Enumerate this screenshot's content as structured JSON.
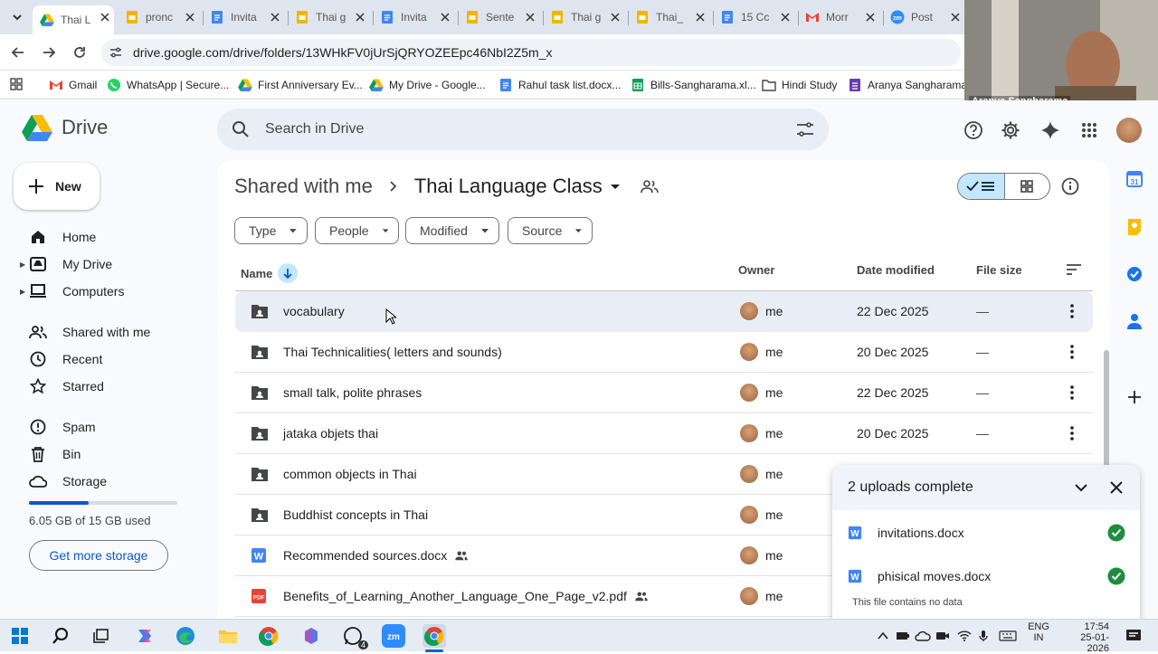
{
  "browser": {
    "tabs": [
      {
        "label": "Thai L",
        "icon": "drive-icon",
        "active": true
      },
      {
        "label": "pronc",
        "icon": "slides-icon"
      },
      {
        "label": "Invita",
        "icon": "docs-icon"
      },
      {
        "label": "Thai g",
        "icon": "slides-icon"
      },
      {
        "label": "Invita",
        "icon": "docs-icon"
      },
      {
        "label": "Sente",
        "icon": "slides-icon"
      },
      {
        "label": "Thai g",
        "icon": "slides-icon"
      },
      {
        "label": "Thai_",
        "icon": "slides-icon"
      },
      {
        "label": "15 Cc",
        "icon": "docs-icon"
      },
      {
        "label": "Morr",
        "icon": "gmail-icon"
      },
      {
        "label": "Post",
        "icon": "zoom-icon"
      }
    ],
    "url": "drive.google.com/drive/folders/13WHkFV0jUrSjQRYOZEEpc46NbI2Z5m_x",
    "bookmarks": [
      {
        "label": "Gmail"
      },
      {
        "label": "WhatsApp | Secure..."
      },
      {
        "label": "First Anniversary Ev..."
      },
      {
        "label": "My Drive - Google..."
      },
      {
        "label": "Rahul task list.docx..."
      },
      {
        "label": "Bills-Sangharama.xl..."
      },
      {
        "label": "Hindi Study"
      },
      {
        "label": "Aranya Sangharama..."
      }
    ]
  },
  "webcam": {
    "caption": "Aranya Sangharama"
  },
  "drive": {
    "app_name": "Drive",
    "search_placeholder": "Search in Drive",
    "new_label": "New",
    "nav": [
      {
        "label": "Home"
      },
      {
        "label": "My Drive"
      },
      {
        "label": "Computers"
      },
      {
        "label": "Shared with me"
      },
      {
        "label": "Recent"
      },
      {
        "label": "Starred"
      },
      {
        "label": "Spam"
      },
      {
        "label": "Bin"
      },
      {
        "label": "Storage"
      }
    ],
    "storage": {
      "text": "6.05 GB of 15 GB used",
      "used_fraction": 0.403,
      "button": "Get more storage"
    },
    "breadcrumb": {
      "parent": "Shared with me",
      "current": "Thai Language Class"
    },
    "filters": [
      "Type",
      "People",
      "Modified",
      "Source"
    ],
    "columns": {
      "name": "Name",
      "owner": "Owner",
      "date": "Date modified",
      "size": "File size"
    },
    "files": [
      {
        "name": "vocabulary",
        "type": "folder",
        "owner": "me",
        "date": "22 Dec 2025",
        "size": "—",
        "shared": false
      },
      {
        "name": "Thai Technicalities( letters and sounds)",
        "type": "folder",
        "owner": "me",
        "date": "20 Dec 2025",
        "size": "—",
        "shared": false
      },
      {
        "name": "small talk, polite phrases",
        "type": "folder",
        "owner": "me",
        "date": "22 Dec 2025",
        "size": "—",
        "shared": false
      },
      {
        "name": "jataka objets thai",
        "type": "folder",
        "owner": "me",
        "date": "20 Dec 2025",
        "size": "—",
        "shared": false
      },
      {
        "name": "common objects in Thai",
        "type": "folder",
        "owner": "me",
        "date": "",
        "size": "",
        "shared": false
      },
      {
        "name": "Buddhist concepts in Thai",
        "type": "folder",
        "owner": "me",
        "date": "",
        "size": "",
        "shared": false
      },
      {
        "name": "Recommended sources.docx",
        "type": "docx",
        "owner": "me",
        "date": "",
        "size": "",
        "shared": true
      },
      {
        "name": "Benefits_of_Learning_Another_Language_One_Page_v2.pdf",
        "type": "pdf",
        "owner": "me",
        "date": "",
        "size": "",
        "shared": true
      }
    ],
    "upload": {
      "title": "2 uploads complete",
      "items": [
        {
          "name": "invitations.docx"
        },
        {
          "name": "phisical moves.docx"
        }
      ],
      "note": "This file contains no data"
    }
  },
  "taskbar": {
    "lang": "ENG",
    "region": "IN",
    "time": "17:54",
    "date": "25-01-2026",
    "whatsapp_badge": "4"
  },
  "colors": {
    "accent": "#0b57d0",
    "selected": "#c2e7ff",
    "folder": "#444746",
    "word": "#4285f4",
    "pdf": "#ea4335"
  }
}
